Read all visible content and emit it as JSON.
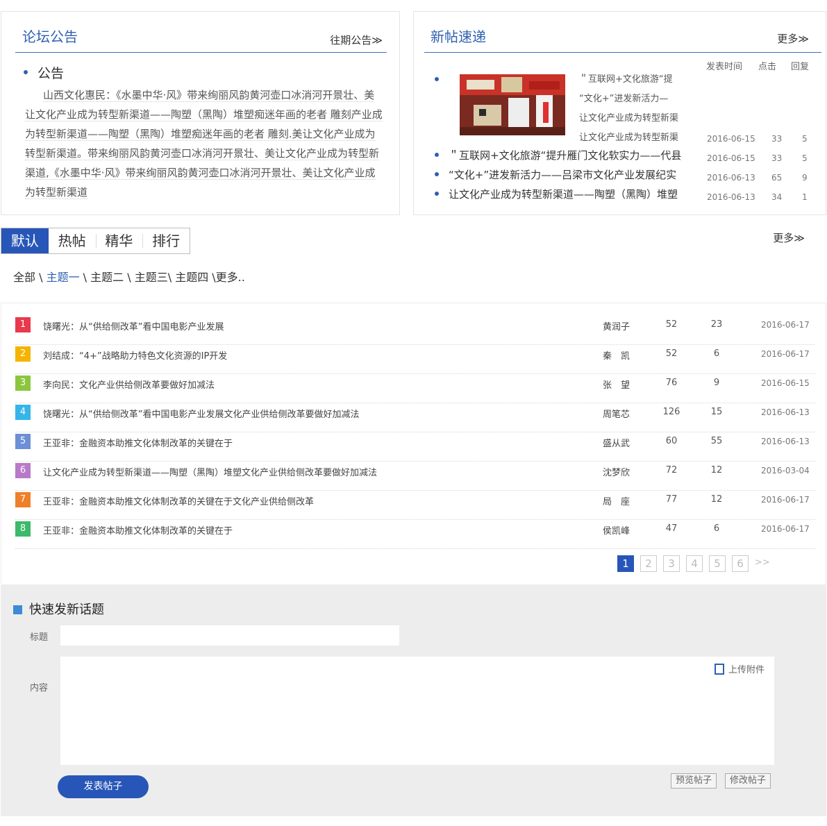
{
  "notice": {
    "title": "论坛公告",
    "more": "往期公告≫",
    "head": "公告",
    "body": "山西文化惠民：《水墨中华·风》带来绚丽风韵黄河壶口冰消河开景壮、美让文化产业成为转型新渠道——陶塑（黑陶）堆塑痴迷年画的老者 雕刻产业成为转型新渠道——陶塑（黑陶）堆塑痴迷年画的老者 雕刻.美让文化产业成为转型新渠道。带来绚丽风韵黄河壶口冰消河开景壮、美让文化产业成为转型新渠道,《水墨中华·风》带来绚丽风韵黄河壶口冰消河开景壮、美让文化产业成为转型新渠道"
  },
  "newposts": {
    "title": "新帖速递",
    "more": "更多≫",
    "cols": {
      "time": "发表时间",
      "clicks": "点击",
      "replies": "回复"
    },
    "featured": {
      "lines": [
        "＂互联网+文化旅游“提",
        "“文化+”进发新活力—",
        "让文化产业成为转型新渠",
        "让文化产业成为转型新渠"
      ],
      "date": "2016-06-15",
      "clicks": "33",
      "replies": "5"
    },
    "rows": [
      {
        "title": "＂互联网+文化旅游“提升雁门文化软实力——代县",
        "date": "2016-06-15",
        "clicks": "33",
        "replies": "5"
      },
      {
        "title": "“文化+”进发新活力——吕梁市文化产业发展纪实",
        "date": "2016-06-13",
        "clicks": "65",
        "replies": "9"
      },
      {
        "title": "让文化产业成为转型新渠道——陶塑（黑陶）堆塑",
        "date": "2016-06-13",
        "clicks": "34",
        "replies": "1"
      }
    ]
  },
  "tabs": {
    "items": [
      "默认",
      "热帖",
      "精华",
      "排行"
    ],
    "more": "更多≫"
  },
  "crumbs": {
    "all": "全部",
    "sep": " \\ ",
    "cur": "主题一",
    "rest": " \\ 主题二 \\ 主题三\\ 主题四 \\更多.."
  },
  "list": [
    {
      "n": "1",
      "color": "#e8394d",
      "title": "饶曙光：从“供给侧改革”看中国电影产业发展",
      "author": "黄润子",
      "c1": "52",
      "c2": "23",
      "date": "2016-06-17"
    },
    {
      "n": "2",
      "color": "#f5b400",
      "title": "刘结成：“4+”战略助力特色文化资源的IP开发",
      "author": "秦　凯",
      "c1": "52",
      "c2": "6",
      "date": "2016-06-17"
    },
    {
      "n": "3",
      "color": "#8cc63f",
      "title": "李向民：文化产业供给侧改革要做好加减法",
      "author": "张　望",
      "c1": "76",
      "c2": "9",
      "date": "2016-06-15"
    },
    {
      "n": "4",
      "color": "#35b5e8",
      "title": "饶曙光：从“供给侧改革”看中国电影产业发展文化产业供给侧改革要做好加减法",
      "author": "周笔芯",
      "c1": "126",
      "c2": "15",
      "date": "2016-06-13"
    },
    {
      "n": "5",
      "color": "#6c8fd6",
      "title": "王亚非：金融资本助推文化体制改革的关键在于",
      "author": "盛从武",
      "c1": "60",
      "c2": "55",
      "date": "2016-06-13"
    },
    {
      "n": "6",
      "color": "#b87ac8",
      "title": "让文化产业成为转型新渠道——陶塑（黑陶）堆塑文化产业供给侧改革要做好加减法",
      "author": "沈梦欣",
      "c1": "72",
      "c2": "12",
      "date": "2016-03-04"
    },
    {
      "n": "7",
      "color": "#f07f2a",
      "title": "王亚非：金融资本助推文化体制改革的关键在于文化产业供给侧改革",
      "author": "局　座",
      "c1": "77",
      "c2": "12",
      "date": "2016-06-17"
    },
    {
      "n": "8",
      "color": "#3cb96a",
      "title": "王亚非：金融资本助推文化体制改革的关键在于",
      "author": "侯凯峰",
      "c1": "47",
      "c2": "6",
      "date": "2016-06-17"
    }
  ],
  "pager": {
    "pages": [
      "1",
      "2",
      "3",
      "4",
      "5",
      "6"
    ],
    "next": ">>"
  },
  "quick": {
    "title": "快速发新话题",
    "title_label": "标题",
    "content_label": "内容",
    "upload": "上传附件",
    "submit": "发表帖子",
    "preview": "预览帖子",
    "edit": "修改帖子"
  }
}
